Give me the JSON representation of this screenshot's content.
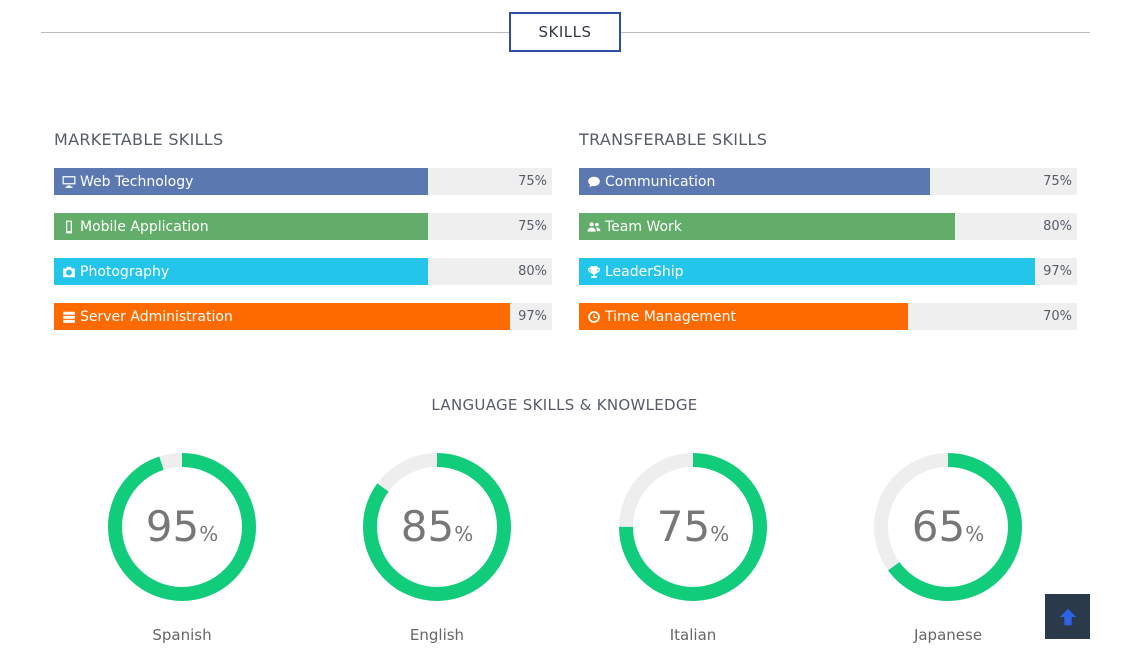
{
  "section": {
    "title": "SKILLS"
  },
  "marketable": {
    "heading": "MARKETABLE SKILLS",
    "items": [
      {
        "label": "Web Technology",
        "value": 75,
        "pct": "75%",
        "color": "#5b79b0",
        "icon": "desktop-icon"
      },
      {
        "label": "Mobile Application",
        "value": 75,
        "pct": "75%",
        "color": "#63ad6a",
        "icon": "mobile-icon"
      },
      {
        "label": "Photography",
        "value": 75,
        "pct": "80%",
        "color": "#23c6ea",
        "icon": "camera-icon"
      },
      {
        "label": "Server Administration",
        "value": 91.5,
        "pct": "97%",
        "color": "#ff6a00",
        "icon": "server-icon"
      }
    ]
  },
  "transferable": {
    "heading": "TRANSFERABLE SKILLS",
    "items": [
      {
        "label": "Communication",
        "value": 70.5,
        "pct": "75%",
        "color": "#5b79b0",
        "icon": "comments-icon"
      },
      {
        "label": "Team Work",
        "value": 75.5,
        "pct": "80%",
        "color": "#63ad6a",
        "icon": "users-icon"
      },
      {
        "label": "LeaderShip",
        "value": 91.5,
        "pct": "97%",
        "color": "#23c6ea",
        "icon": "trophy-icon"
      },
      {
        "label": "Time Management",
        "value": 66,
        "pct": "70%",
        "color": "#ff6a00",
        "icon": "clock-icon"
      }
    ]
  },
  "languages": {
    "heading": "LANGUAGE SKILLS & KNOWLEDGE",
    "items": [
      {
        "name": "Spanish",
        "value": 95,
        "number": "95",
        "unit": "%"
      },
      {
        "name": "English",
        "value": 85,
        "number": "85",
        "unit": "%"
      },
      {
        "name": "Italian",
        "value": 75,
        "number": "75",
        "unit": "%"
      },
      {
        "name": "Japanese",
        "value": 65,
        "number": "65",
        "unit": "%"
      }
    ],
    "ring_color": "#11cc7a",
    "track_color": "#eeeeee"
  },
  "back_to_top": {
    "icon": "arrow-up-icon",
    "color": "#2b3a4a"
  }
}
